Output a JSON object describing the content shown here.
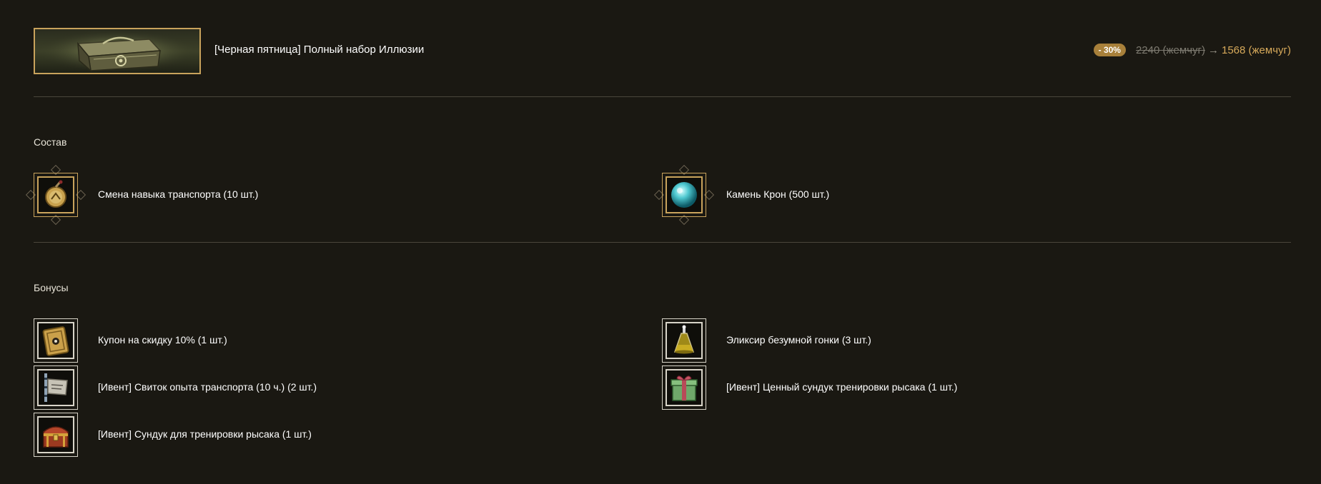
{
  "product": {
    "icon": "chest-icon",
    "name": "[Черная пятница] Полный набор Иллюзии",
    "discount": "- 30%",
    "old_price": "2240 (жемчуг)",
    "arrow": "→",
    "new_price": "1568 (жемчуг)"
  },
  "composition": {
    "title": "Состав",
    "items": [
      {
        "label": "Смена навыка транспорта (10 шт.)",
        "icon": "mount-skill-change-icon"
      },
      {
        "label": "Камень Крон (500 шт.)",
        "icon": "cron-stone-icon"
      }
    ]
  },
  "bonuses": {
    "title": "Бонусы",
    "items": [
      {
        "label": "Купон на скидку 10% (1 шт.)",
        "icon": "coupon-icon"
      },
      {
        "label": "Эликсир безумной гонки (3 шт.)",
        "icon": "elixir-icon"
      },
      {
        "label": "[Ивент] Свиток опыта транспорта (10 ч.) (2 шт.)",
        "icon": "scroll-icon"
      },
      {
        "label": "[Ивент] Ценный сундук тренировки рысака (1 шт.)",
        "icon": "gift-box-icon"
      },
      {
        "label": "[Ивент] Сундук для тренировки рысака (1 шт.)",
        "icon": "treasure-chest-icon"
      }
    ]
  },
  "colors": {
    "background": "#1a1812",
    "accent_gold": "#c9a35c",
    "new_price": "#d6a95a",
    "badge": "#a8803a"
  }
}
